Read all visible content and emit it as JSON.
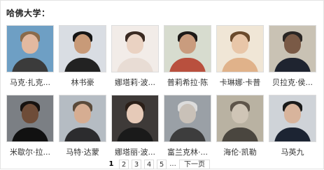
{
  "section_title": "哈佛大学：",
  "people": [
    {
      "name": "马克·扎克...",
      "colors": {
        "bg": "#6e9fc4",
        "hair": "#8a6b4b",
        "skin": "#e2b9a0",
        "body": "#3b3b3b"
      }
    },
    {
      "name": "林书豪",
      "colors": {
        "bg": "#d9dde3",
        "hair": "#151515",
        "skin": "#c89a78",
        "body": "#222222"
      }
    },
    {
      "name": "娜塔莉·波...",
      "colors": {
        "bg": "#f2ece8",
        "hair": "#3a2a22",
        "skin": "#ead2c2",
        "body": "#e8dcd4"
      }
    },
    {
      "name": "普莉希拉·陈",
      "colors": {
        "bg": "#d7dccf",
        "hair": "#1d1a18",
        "skin": "#c99c7e",
        "body": "#b9503e"
      }
    },
    {
      "name": "卡琳娜·卡普",
      "colors": {
        "bg": "#f0e6d6",
        "hair": "#6a4a2c",
        "skin": "#e8c6a8",
        "body": "#e0b28a"
      }
    },
    {
      "name": "贝拉克·侯...",
      "colors": {
        "bg": "#c9c2b4",
        "hair": "#2a2624",
        "skin": "#7a5a46",
        "body": "#1f2430"
      }
    },
    {
      "name": "米歇尔·拉...",
      "colors": {
        "bg": "#7b7f84",
        "hair": "#161210",
        "skin": "#6e4c38",
        "body": "#111111"
      }
    },
    {
      "name": "马特·达蒙",
      "colors": {
        "bg": "#b5bcc3",
        "hair": "#5a4a3a",
        "skin": "#d6ad92",
        "body": "#2c2c2e"
      }
    },
    {
      "name": "娜塔丽·波...",
      "colors": {
        "bg": "#3e3a38",
        "hair": "#2b1f18",
        "skin": "#e6cab8",
        "body": "#1a1a1a"
      }
    },
    {
      "name": "富兰克林·...",
      "colors": {
        "bg": "#9aa0a6",
        "hair": "#dcdcdc",
        "skin": "#c9c1b8",
        "body": "#3d3d3d"
      }
    },
    {
      "name": "海伦·凯勒",
      "colors": {
        "bg": "#b9b2a2",
        "hair": "#5e554a",
        "skin": "#cfc5b6",
        "body": "#4a463f"
      }
    },
    {
      "name": "马英九",
      "colors": {
        "bg": "#cfd3d8",
        "hair": "#1a1a1a",
        "skin": "#d8b49c",
        "body": "#1c2433"
      }
    }
  ],
  "pagination": {
    "pages": [
      "1",
      "2",
      "3",
      "4",
      "5"
    ],
    "current": "1",
    "ellipsis": "...",
    "next_label": "下一页"
  }
}
